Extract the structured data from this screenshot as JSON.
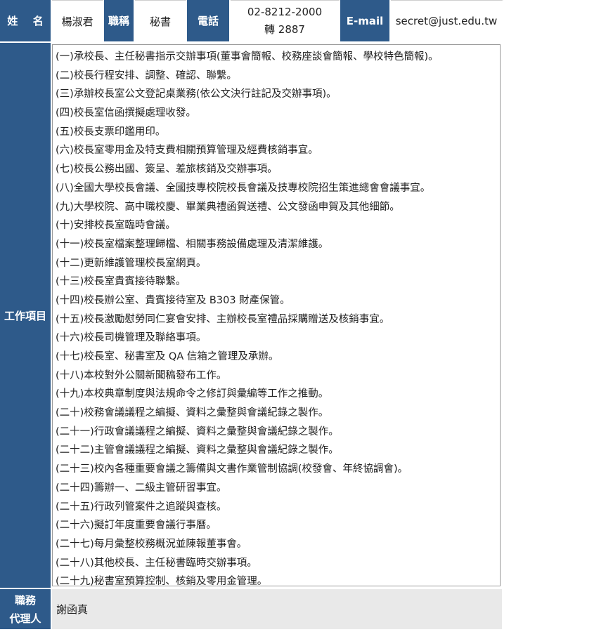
{
  "header": {
    "name_label": "姓 名",
    "name_value": "楊淑君",
    "title_label": "職稱",
    "title_value": "秘書",
    "phone_label": "電話",
    "phone_line1": "02-8212-2000",
    "phone_line2": "轉 2887",
    "email_label": "E-mail",
    "email_value": "secret@just.edu.tw"
  },
  "duties": {
    "label": "工作項目",
    "items": [
      "(一)承校長、主任秘書指示交辦事項(董事會簡報、校務座談會簡報、學校特色簡報)。",
      "(二)校長行程安排、調整、確認、聯繫。",
      "(三)承辦校長室公文登記桌業務(依公文決行註記及交辦事項)。",
      "(四)校長室信函撰擬處理收發。",
      "(五)校長支票印鑑用印。",
      "(六)校長室零用金及特支費相關預算管理及經費核銷事宜。",
      "(七)校長公務出國、簽呈、差旅核銷及交辦事項。",
      "(八)全國大學校長會議、全國技專校院校長會議及技專校院招生策進總會會議事宜。",
      "(九)大學校院、高中職校慶、畢業典禮函賀送禮、公文發函申賀及其他細節。",
      "(十)安排校長室臨時會議。",
      "(十一)校長室檔案整理歸檔、相關事務設備處理及清潔維護。",
      "(十二)更新維護管理校長室網頁。",
      "(十三)校長室貴賓接待聯繫。",
      "(十四)校長辦公室、貴賓接待室及 B303 財產保管。",
      "(十五)校長激勵慰勞同仁宴會安排、主辦校長室禮品採購贈送及核銷事宜。",
      "(十六)校長司機管理及聯絡事項。",
      "(十七)校長室、秘書室及 QA 信箱之管理及承辦。",
      "(十八)本校對外公關新聞稿發布工作。",
      "(十九)本校典章制度與法規命令之修訂與彙編等工作之推動。",
      "(二十)校務會議議程之編擬、資料之彙整與會議紀錄之製作。",
      "(二十一)行政會議議程之編擬、資料之彙整與會議紀錄之製作。",
      "(二十二)主管會議議程之編擬、資料之彙整與會議紀錄之製作。",
      "(二十三)校內各種重要會議之籌備與文書作業管制協調(校發會、年終協調會)。",
      "(二十四)籌辦一、二級主管研習事宜。",
      "(二十五)行政列管案件之追蹤與查核。",
      "(二十六)擬訂年度重要會議行事曆。",
      "(二十七)每月彙整校務概況並陳報董事會。",
      "(二十八)其他校長、主任秘書臨時交辦事項。",
      "(二十九)秘書室預算控制、核銷及零用金管理。"
    ]
  },
  "agent": {
    "label_line1": "職務",
    "label_line2": "代理人",
    "value": "謝函真"
  },
  "colors": {
    "header_blue": "#2e5a8a",
    "agent_bg": "#e9e9e9"
  }
}
